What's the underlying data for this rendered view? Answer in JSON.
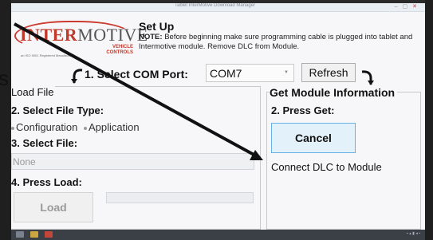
{
  "window": {
    "title": "Tablet InterMotive Download Manager",
    "controls": "–  ▢  ✕"
  },
  "logo": {
    "brand_part1": "INTER",
    "brand_part2": "MOTIVE",
    "brand_sub": "VEHICLE CONTROLS",
    "tagline": "an ISO 9001 Registered Manufacturer"
  },
  "setup": {
    "title": "Set Up",
    "note_label": "NOTE:",
    "note_text": "Before beginning make sure programming cable is plugged into tablet and Intermotive module. Remove DLC from Module."
  },
  "com_port": {
    "label": "1. Select COM Port:",
    "value": "COM7",
    "refresh_label": "Refresh"
  },
  "load_file": {
    "title": "Load File",
    "step2_label": "2. Select File Type:",
    "options": [
      "Configuration",
      "Application"
    ],
    "step3_label": "3. Select File:",
    "file_value": "None",
    "step4_label": "4. Press Load:",
    "load_button": "Load"
  },
  "module_info": {
    "title": "Get Module Information",
    "step2_label": "2. Press Get:",
    "cancel_button": "Cancel",
    "status": "Connect DLC to Module"
  },
  "outside": {
    "left_s": "s"
  },
  "colors": {
    "accent_blue": "#67b2e5",
    "brand_red": "#c0392b",
    "taskbar": "#3b3f46"
  }
}
